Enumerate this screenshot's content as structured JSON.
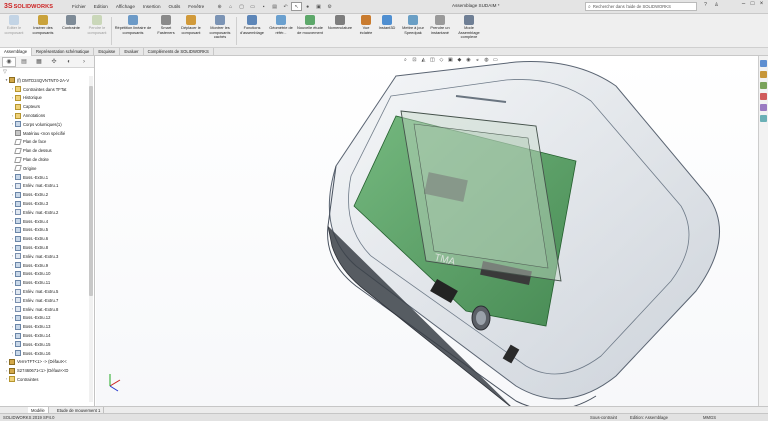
{
  "app": {
    "logo_mark": "3S",
    "logo_text": "SOLIDWORKS",
    "menu": [
      "Fichier",
      "Edition",
      "Affichage",
      "Insertion",
      "Outils",
      "Fenêtre"
    ],
    "doc_title": "Assemblage SUDAIM *",
    "search_placeholder": "Rechercher dans l'aide de SOLIDWORKS"
  },
  "commands": [
    {
      "label": "Editer le composant",
      "disabled": true,
      "color": "#8fb3d9"
    },
    {
      "label": "Insérer des composants",
      "disabled": false,
      "color": "#c9a23b"
    },
    {
      "label": "Contrainte",
      "disabled": false,
      "color": "#7e8b97"
    },
    {
      "label": "Pendre le composant",
      "disabled": true,
      "color": "#9dbb77"
    },
    {
      "label": "Répétition linéaire de composants",
      "disabled": false,
      "color": "#6c9ac7"
    },
    {
      "label": "Smart Fasteners",
      "disabled": false,
      "color": "#8a8a8a"
    },
    {
      "label": "Déplacer le composant",
      "disabled": false,
      "color": "#d19a3a"
    },
    {
      "label": "Montrer les composants cachés",
      "disabled": false,
      "color": "#7b94b5"
    },
    {
      "label": "Fonctions d'assemblage",
      "disabled": false,
      "color": "#5d86b8"
    },
    {
      "label": "Géométrie de référ...",
      "disabled": false,
      "color": "#6aa0cf"
    },
    {
      "label": "Nouvelle étude de mouvement",
      "disabled": false,
      "color": "#5da86a"
    },
    {
      "label": "Nomenclature",
      "disabled": false,
      "color": "#7d7d7d"
    },
    {
      "label": "Vue éclatée",
      "disabled": false,
      "color": "#c97b2e"
    },
    {
      "label": "Instant3D",
      "disabled": false,
      "color": "#4f8fd1"
    },
    {
      "label": "Mettre à jour Speedpak",
      "disabled": false,
      "color": "#6a9fc5"
    },
    {
      "label": "Prendre un instantané",
      "disabled": false,
      "color": "#9a9a9a"
    },
    {
      "label": "Mode Assemblage complexe",
      "disabled": false,
      "color": "#6f7f95"
    }
  ],
  "tabs": [
    "Assemblage",
    "Représentation schématique",
    "Esquisse",
    "Evaluer",
    "Compléments de SOLIDWORKS"
  ],
  "tree": [
    {
      "label": "(f) DMTD24QVNTNT0-2A-V",
      "icon": "comp",
      "arrow": "▾",
      "indent": 4
    },
    {
      "label": "Contraintes dans TFTat",
      "icon": "fold",
      "arrow": "›",
      "indent": 10
    },
    {
      "label": "Historique",
      "icon": "fold",
      "arrow": "›",
      "indent": 10
    },
    {
      "label": "Capteurs",
      "icon": "fold",
      "arrow": "",
      "indent": 10
    },
    {
      "label": "Annotations",
      "icon": "fold",
      "arrow": "›",
      "indent": 10
    },
    {
      "label": "Corps volumiques(1)",
      "icon": "feat",
      "arrow": "›",
      "indent": 10
    },
    {
      "label": "Matériau <non spécifié",
      "icon": "mat",
      "arrow": "",
      "indent": 10
    },
    {
      "label": "Plan de face",
      "icon": "plane",
      "arrow": "",
      "indent": 10
    },
    {
      "label": "Plan de dessus",
      "icon": "plane",
      "arrow": "",
      "indent": 10
    },
    {
      "label": "Plan de droite",
      "icon": "plane",
      "arrow": "",
      "indent": 10
    },
    {
      "label": "Origine",
      "icon": "plane",
      "arrow": "",
      "indent": 10
    },
    {
      "label": "Boss.-Extru.1",
      "icon": "feat",
      "arrow": "›",
      "indent": 10
    },
    {
      "label": "Enlèv. mat.-Extru.1",
      "icon": "cut",
      "arrow": "›",
      "indent": 10
    },
    {
      "label": "Boss.-Extru.2",
      "icon": "feat",
      "arrow": "›",
      "indent": 10
    },
    {
      "label": "Boss.-Extru.3",
      "icon": "feat",
      "arrow": "›",
      "indent": 10
    },
    {
      "label": "Enlèv. mat.-Extru.2",
      "icon": "cut",
      "arrow": "›",
      "indent": 10
    },
    {
      "label": "Boss.-Extru.4",
      "icon": "feat",
      "arrow": "›",
      "indent": 10
    },
    {
      "label": "Boss.-Extru.5",
      "icon": "feat",
      "arrow": "›",
      "indent": 10
    },
    {
      "label": "Boss.-Extru.6",
      "icon": "feat",
      "arrow": "›",
      "indent": 10
    },
    {
      "label": "Boss.-Extru.8",
      "icon": "feat",
      "arrow": "›",
      "indent": 10
    },
    {
      "label": "Enlèv. mat.-Extru.3",
      "icon": "cut",
      "arrow": "›",
      "indent": 10
    },
    {
      "label": "Boss.-Extru.9",
      "icon": "feat",
      "arrow": "›",
      "indent": 10
    },
    {
      "label": "Boss.-Extru.10",
      "icon": "feat",
      "arrow": "›",
      "indent": 10
    },
    {
      "label": "Boss.-Extru.11",
      "icon": "feat",
      "arrow": "›",
      "indent": 10
    },
    {
      "label": "Enlèv. mat.-Extru.5",
      "icon": "cut",
      "arrow": "›",
      "indent": 10
    },
    {
      "label": "Enlèv. mat.-Extru.7",
      "icon": "cut",
      "arrow": "›",
      "indent": 10
    },
    {
      "label": "Enlèv. mat.-Extru.8",
      "icon": "cut",
      "arrow": "›",
      "indent": 10
    },
    {
      "label": "Boss.-Extru.12",
      "icon": "feat",
      "arrow": "›",
      "indent": 10
    },
    {
      "label": "Boss.-Extru.13",
      "icon": "feat",
      "arrow": "›",
      "indent": 10
    },
    {
      "label": "Boss.-Extru.14",
      "icon": "feat",
      "arrow": "›",
      "indent": 10
    },
    {
      "label": "Boss.-Extru.15",
      "icon": "feat",
      "arrow": "›",
      "indent": 10
    },
    {
      "label": "Boss.-Extru.16",
      "icon": "feat",
      "arrow": "›",
      "indent": 10
    },
    {
      "label": "VerreTFT<1> -> (Défaut<<",
      "icon": "comp",
      "arrow": "›",
      "indent": 4
    },
    {
      "label": "S27460671<1> (Défaut<<D",
      "icon": "comp",
      "arrow": "›",
      "indent": 4
    },
    {
      "label": "Contraintes",
      "icon": "fold",
      "arrow": "›",
      "indent": 4
    }
  ],
  "viewport": {
    "pcb_label": "TMA"
  },
  "bottom_tabs": [
    "Modèle",
    "Etude de mouvement 1"
  ],
  "status": {
    "version": "SOLIDWORKS 2019 SP4.0",
    "state": "Sous-contraint",
    "mode": "Edition: Assemblage",
    "units": "MMGS"
  },
  "colors": {
    "accent": "#cc1f1f",
    "pcb_green": "#3d8f4a",
    "shell": "#7e8da0"
  }
}
